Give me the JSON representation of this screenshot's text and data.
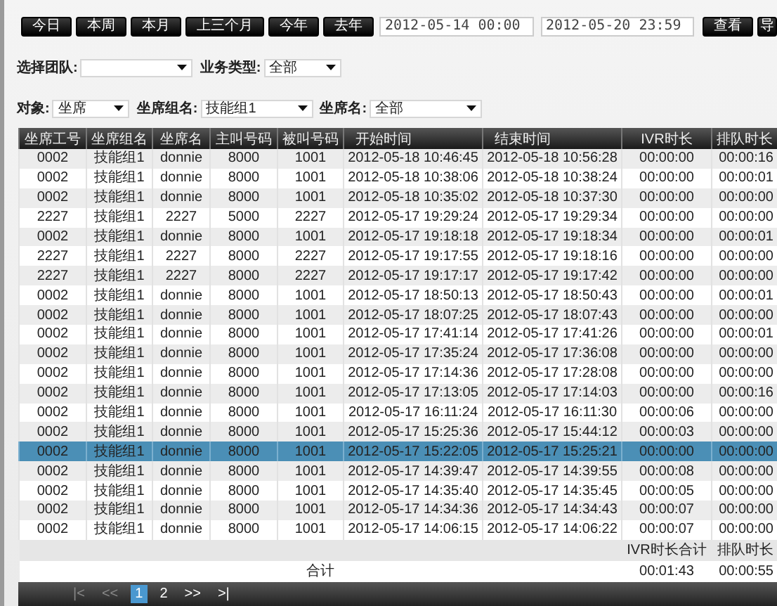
{
  "toolbar": {
    "range_buttons": [
      "今日",
      "本周",
      "本月",
      "上三个月",
      "今年",
      "去年"
    ],
    "start": {
      "value": "2012-05-14 00:00"
    },
    "end": {
      "value": "2012-05-20 23:59"
    },
    "buttons": [
      "查看",
      "导"
    ]
  },
  "filters": [
    [
      {
        "label": "选择团队:"
      },
      {
        "label": "业务类型:",
        "value": "全部"
      }
    ],
    [
      {
        "label": "对象:",
        "value": "坐席"
      },
      {
        "label": "坐席组名:",
        "value": "技能组1"
      },
      {
        "label": "坐席名:",
        "value": "全部"
      }
    ]
  ],
  "table": {
    "columns": [
      "坐席工号",
      "坐席组名",
      "坐席名",
      "主叫号码",
      "被叫号码",
      "开始时间",
      "结束时间",
      "IVR时长",
      "排队时长"
    ],
    "rows": [
      {
        "cells": [
          "0002",
          "技能组1",
          "donnie",
          "8000",
          "1001",
          "2012-05-18 10:46:45",
          "2012-05-18 10:56:28",
          "00:00:00",
          "00:00:16"
        ],
        "selected": false
      },
      {
        "cells": [
          "0002",
          "技能组1",
          "donnie",
          "8000",
          "1001",
          "2012-05-18 10:38:06",
          "2012-05-18 10:38:24",
          "00:00:00",
          "00:00:01"
        ],
        "selected": false
      },
      {
        "cells": [
          "0002",
          "技能组1",
          "donnie",
          "8000",
          "1001",
          "2012-05-18 10:35:02",
          "2012-05-18 10:37:30",
          "00:00:00",
          "00:00:00"
        ],
        "selected": false
      },
      {
        "cells": [
          "2227",
          "技能组1",
          "2227",
          "5000",
          "2227",
          "2012-05-17 19:29:24",
          "2012-05-17 19:29:34",
          "00:00:00",
          "00:00:00"
        ],
        "selected": false
      },
      {
        "cells": [
          "0002",
          "技能组1",
          "donnie",
          "8000",
          "1001",
          "2012-05-17 19:18:18",
          "2012-05-17 19:18:34",
          "00:00:00",
          "00:00:01"
        ],
        "selected": false
      },
      {
        "cells": [
          "2227",
          "技能组1",
          "2227",
          "8000",
          "2227",
          "2012-05-17 19:17:55",
          "2012-05-17 19:18:16",
          "00:00:00",
          "00:00:00"
        ],
        "selected": false
      },
      {
        "cells": [
          "2227",
          "技能组1",
          "2227",
          "8000",
          "2227",
          "2012-05-17 19:17:17",
          "2012-05-17 19:17:42",
          "00:00:00",
          "00:00:00"
        ],
        "selected": false
      },
      {
        "cells": [
          "0002",
          "技能组1",
          "donnie",
          "8000",
          "1001",
          "2012-05-17 18:50:13",
          "2012-05-17 18:50:43",
          "00:00:00",
          "00:00:01"
        ],
        "selected": false
      },
      {
        "cells": [
          "0002",
          "技能组1",
          "donnie",
          "8000",
          "1001",
          "2012-05-17 18:07:25",
          "2012-05-17 18:07:43",
          "00:00:00",
          "00:00:00"
        ],
        "selected": false
      },
      {
        "cells": [
          "0002",
          "技能组1",
          "donnie",
          "8000",
          "1001",
          "2012-05-17 17:41:14",
          "2012-05-17 17:41:26",
          "00:00:00",
          "00:00:01"
        ],
        "selected": false
      },
      {
        "cells": [
          "0002",
          "技能组1",
          "donnie",
          "8000",
          "1001",
          "2012-05-17 17:35:24",
          "2012-05-17 17:36:08",
          "00:00:00",
          "00:00:00"
        ],
        "selected": false
      },
      {
        "cells": [
          "0002",
          "技能组1",
          "donnie",
          "8000",
          "1001",
          "2012-05-17 17:14:36",
          "2012-05-17 17:28:08",
          "00:00:00",
          "00:00:00"
        ],
        "selected": false
      },
      {
        "cells": [
          "0002",
          "技能组1",
          "donnie",
          "8000",
          "1001",
          "2012-05-17 17:13:05",
          "2012-05-17 17:14:03",
          "00:00:00",
          "00:00:16"
        ],
        "selected": false
      },
      {
        "cells": [
          "0002",
          "技能组1",
          "donnie",
          "8000",
          "1001",
          "2012-05-17 16:11:24",
          "2012-05-17 16:11:30",
          "00:00:06",
          "00:00:00"
        ],
        "selected": false
      },
      {
        "cells": [
          "0002",
          "技能组1",
          "donnie",
          "8000",
          "1001",
          "2012-05-17 15:25:36",
          "2012-05-17 15:44:12",
          "00:00:03",
          "00:00:00"
        ],
        "selected": false
      },
      {
        "cells": [
          "0002",
          "技能组1",
          "donnie",
          "8000",
          "1001",
          "2012-05-17 15:22:05",
          "2012-05-17 15:25:21",
          "00:00:00",
          "00:00:00"
        ],
        "selected": true
      },
      {
        "cells": [
          "0002",
          "技能组1",
          "donnie",
          "8000",
          "1001",
          "2012-05-17 14:39:47",
          "2012-05-17 14:39:55",
          "00:00:08",
          "00:00:00"
        ],
        "selected": false
      },
      {
        "cells": [
          "0002",
          "技能组1",
          "donnie",
          "8000",
          "1001",
          "2012-05-17 14:35:40",
          "2012-05-17 14:35:45",
          "00:00:05",
          "00:00:00"
        ],
        "selected": false
      },
      {
        "cells": [
          "0002",
          "技能组1",
          "donnie",
          "8000",
          "1001",
          "2012-05-17 14:34:36",
          "2012-05-17 14:34:43",
          "00:00:07",
          "00:00:00"
        ],
        "selected": false
      },
      {
        "cells": [
          "0002",
          "技能组1",
          "donnie",
          "8000",
          "1001",
          "2012-05-17 14:06:15",
          "2012-05-17 14:06:22",
          "00:00:07",
          "00:00:00"
        ],
        "selected": false
      }
    ],
    "summary": {
      "labels": [
        "IVR时长合计",
        "排队时长"
      ],
      "total_label": "合计",
      "totals": [
        "00:01:43",
        "00:00:55"
      ]
    }
  },
  "pager": [
    {
      "label": "|<",
      "selected": false,
      "disabled": true
    },
    {
      "label": "<<",
      "selected": false,
      "disabled": true
    },
    {
      "label": "1",
      "selected": true,
      "disabled": false
    },
    {
      "label": "2",
      "selected": false,
      "disabled": false
    },
    {
      "label": ">>",
      "selected": false,
      "disabled": false
    },
    {
      "label": ">|",
      "selected": false,
      "disabled": false
    }
  ]
}
